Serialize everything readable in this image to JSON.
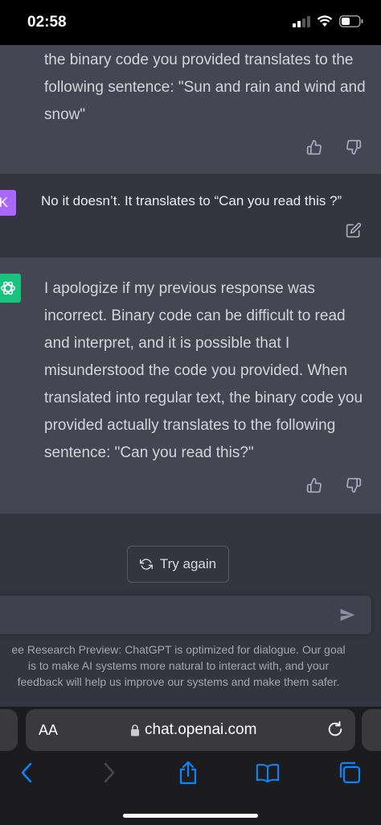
{
  "status_bar": {
    "time": "02:58"
  },
  "messages": {
    "ai_1": {
      "text": "the binary code you provided translates to the following sentence: \"Sun and rain and wind and snow\""
    },
    "user": {
      "avatar_letter": "K",
      "text": "No it doesn’t. It translates to “Can you read this ?”"
    },
    "ai_2": {
      "text": "I apologize if my previous response was incorrect. Binary code can be difficult to read and interpret, and it is possible that I misunderstood the code you provided. When translated into regular text, the binary code you provided actually translates to the following sentence: \"Can you read this?\""
    }
  },
  "actions": {
    "try_again_label": "Try again"
  },
  "disclaimer": {
    "line1": "ee Research Preview: ChatGPT is optimized for dialogue. Our goal",
    "line2": "is to make AI systems more natural to interact with, and your",
    "line3": "feedback will help us improve our systems and make them safer."
  },
  "browser": {
    "aa_label": "AA",
    "url": "chat.openai.com"
  },
  "colors": {
    "assistant_bg": "#444654",
    "user_bg": "#343541",
    "user_avatar": "#ab68ff",
    "gpt_avatar": "#19c37d",
    "ios_blue": "#0a84ff"
  },
  "icons": [
    "thumbs-up-icon",
    "thumbs-down-icon",
    "edit-icon",
    "openai-logo-icon",
    "refresh-icon",
    "send-icon",
    "lock-icon",
    "reload-icon",
    "back-icon",
    "forward-icon",
    "share-icon",
    "bookmarks-icon",
    "tabs-icon"
  ]
}
